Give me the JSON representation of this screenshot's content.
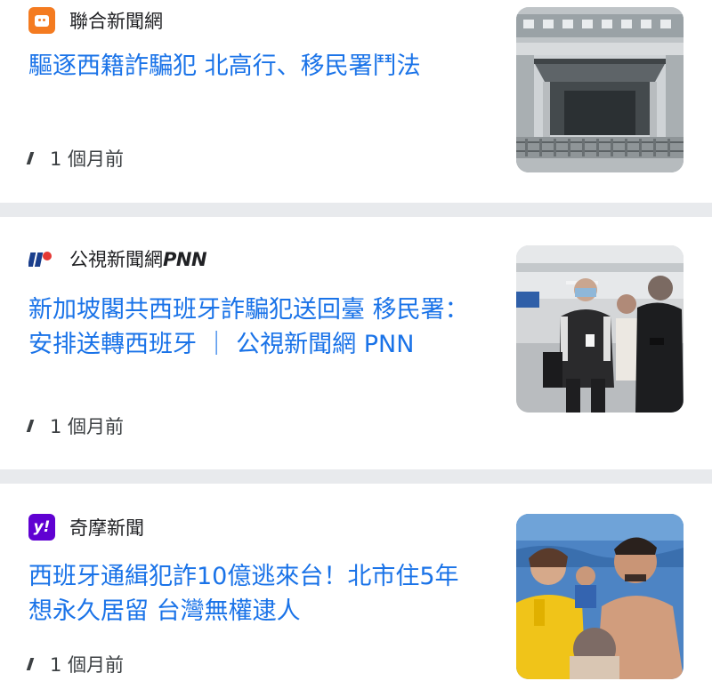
{
  "articles": [
    {
      "source": "聯合新聞網",
      "title": "驅逐西籍詐騙犯 北高行、移民署鬥法",
      "time": "1 個月前",
      "logo_color": "#f47b20"
    },
    {
      "source": "公視新聞網",
      "source_suffix": "PNN",
      "title": "新加坡閣共西班牙詐騙犯送回臺 移民署：安排送轉西班牙 ｜ 公視新聞網 PNN",
      "time": "1 個月前"
    },
    {
      "source": "奇摩新聞",
      "logo_text": "y!",
      "title": "西班牙通緝犯詐10億逃來台！北市住5年想永久居留 台灣無權逮人",
      "time": "1 個月前",
      "logo_color": "#6001d2"
    }
  ],
  "colors": {
    "link": "#1a73e8",
    "separator": "#e8eaed"
  }
}
